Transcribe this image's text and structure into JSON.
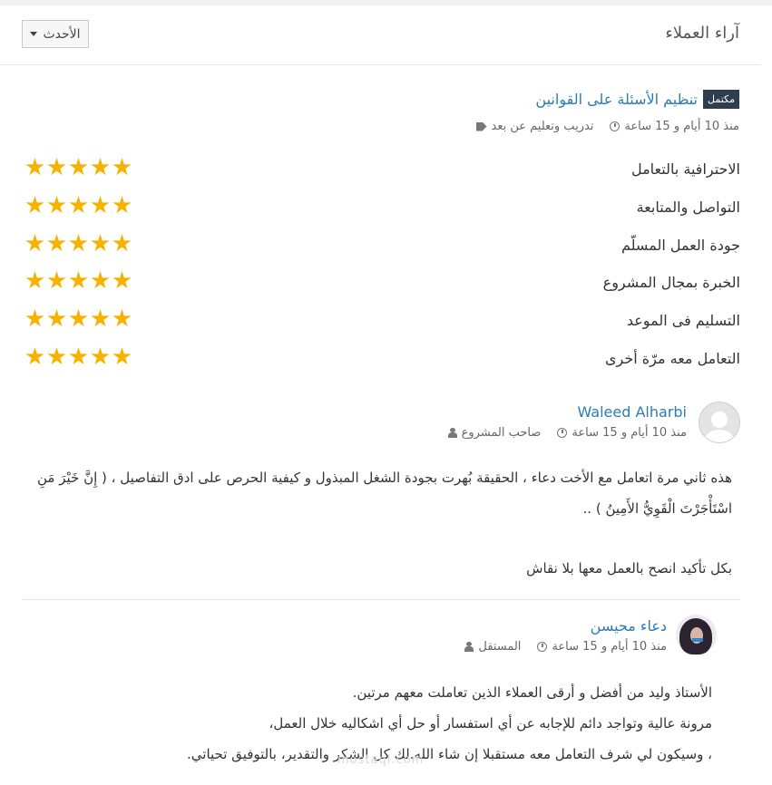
{
  "header": {
    "title": "آراء العملاء",
    "sort_label": "الأحدث"
  },
  "project": {
    "badge": "مكتمل",
    "title": "تنظيم الأسئلة على القوانين",
    "category": "تدريب وتعليم عن بعد",
    "time": "منذ 10 أيام و 15 ساعة"
  },
  "ratings": [
    {
      "label": "الاحترافية بالتعامل",
      "stars": 5
    },
    {
      "label": "التواصل والمتابعة",
      "stars": 5
    },
    {
      "label": "جودة العمل المسلّم",
      "stars": 5
    },
    {
      "label": "الخبرة بمجال المشروع",
      "stars": 5
    },
    {
      "label": "التسليم فى الموعد",
      "stars": 5
    },
    {
      "label": "التعامل معه مرّة أخرى",
      "stars": 5
    }
  ],
  "owner_review": {
    "name": "Waleed Alharbi",
    "role": "صاحب المشروع",
    "time": "منذ 10 أيام و 15 ساعة",
    "line1": "هذه ثاني مرة اتعامل مع الأخت دعاء ، الحقيقة بُهرت بجودة الشغل المبذول و كيفية الحرص على ادق التفاصيل ، ( إِنَّ خَيْرَ مَنِ",
    "line2": "اسْتَأْجَرْتَ الْقَوِيُّ الأَمِينُ ) ..",
    "line3": "بكل تأكيد انصح بالعمل معها بلا نقاش"
  },
  "freelancer_reply": {
    "name": "دعاء محيسن",
    "role": "المستقل",
    "time": "منذ 10 أيام و 15 ساعة",
    "line1": "الأستاذ وليد من أفضل و أرقى العملاء الذين تعاملت معهم مرتين.",
    "line2": "مرونة عالية وتواجد دائم للإجابه عن أي استفسار أو حل أي اشكاليه خلال العمل،",
    "line3": "، وسيكون لي شرف التعامل معه مستقبلا إن شاء الله.لك كل الشكر والتقدير، بالتوفيق تحياتي."
  },
  "watermark": "mostaql.com",
  "colors": {
    "link": "#2b7cb8",
    "star": "#f5b301",
    "badge_bg": "#2f3e4e"
  }
}
